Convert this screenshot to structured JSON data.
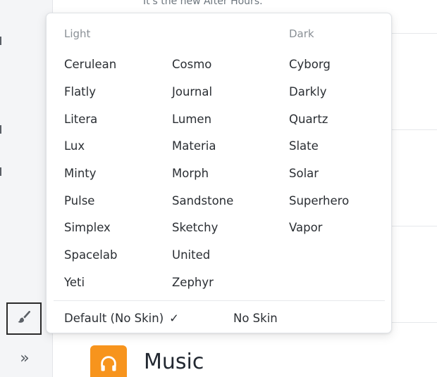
{
  "background": {
    "hint_text": "It's the new After Hours.",
    "section_title": "Music",
    "music_icon": "headphones-icon",
    "accent_color": "#f7941d"
  },
  "sidebar": {
    "skin_button_icon": "paintbrush-icon",
    "expand_icon": "chevron-double-right-icon",
    "expand_glyph": "»"
  },
  "skin_menu": {
    "light_heading": "Light",
    "dark_heading": "Dark",
    "light_col1": [
      "Cerulean",
      "Flatly",
      "Litera",
      "Lux",
      "Minty",
      "Pulse",
      "Simplex",
      "Spacelab",
      "Yeti"
    ],
    "light_col2": [
      "Cosmo",
      "Journal",
      "Lumen",
      "Materia",
      "Morph",
      "Sandstone",
      "Sketchy",
      "United",
      "Zephyr"
    ],
    "dark_col": [
      "Cyborg",
      "Darkly",
      "Quartz",
      "Slate",
      "Solar",
      "Superhero",
      "Vapor"
    ],
    "default_label": "Default (No Skin)",
    "default_checked_glyph": "✓",
    "no_skin_label": "No Skin"
  }
}
